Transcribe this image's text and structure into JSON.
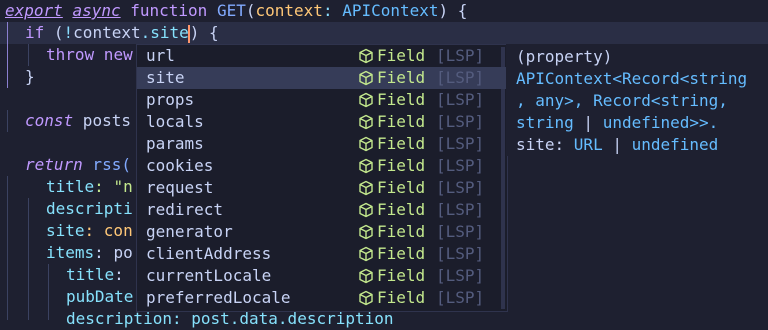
{
  "editor": {
    "line1": {
      "export": "export",
      "async": "async",
      "function": "function",
      "name": "GET",
      "p1": "(",
      "param": "context",
      "colon": ": ",
      "type": "APIContext",
      "p2": ") {"
    },
    "line2": {
      "if": "if",
      "open": " (",
      "bang": "!",
      "obj": "context",
      "dot": ".",
      "prop": "site",
      "close": ")",
      "brace": " {"
    },
    "line3": {
      "throw": "throw",
      "new": " new"
    },
    "line4": {
      "text": "}"
    },
    "line5": {
      "const": "const",
      "rest": " posts"
    },
    "line6": {
      "return": "return",
      "rest": " rss("
    },
    "line7": {
      "key": "title",
      "rest": ": \"n"
    },
    "line8": {
      "key": "descripti"
    },
    "line9": {
      "key": "site",
      "rest": ": con"
    },
    "line10": {
      "key": "items",
      "rest": ": po"
    },
    "line11": {
      "key": "title",
      "rest": ":"
    },
    "line12": {
      "key": "pubDate"
    },
    "line13": {
      "text": "description: post.data.description"
    }
  },
  "completion": {
    "kind": "Field",
    "source": "[LSP]",
    "kind_icon": "cube-icon",
    "selected_index": 1,
    "items": [
      "url",
      "site",
      "props",
      "locals",
      "params",
      "cookies",
      "request",
      "redirect",
      "generator",
      "clientAddress",
      "currentLocale",
      "preferredLocale"
    ]
  },
  "doc": {
    "l1": "(property)",
    "l2": "APIContext<Record<string",
    "l3": ", any>, Record<string,",
    "l4a": "string",
    "l4b": " | ",
    "l4c": "undefined>>.",
    "l5a": "site",
    "l5b": ": ",
    "l5c": "URL",
    "l5d": " | ",
    "l5e": "undefined"
  },
  "colors": {
    "background": "#1e2030",
    "selection": "#363c58",
    "field": "#c3e88d",
    "keyword": "#c099ff",
    "type": "#65bcff"
  }
}
